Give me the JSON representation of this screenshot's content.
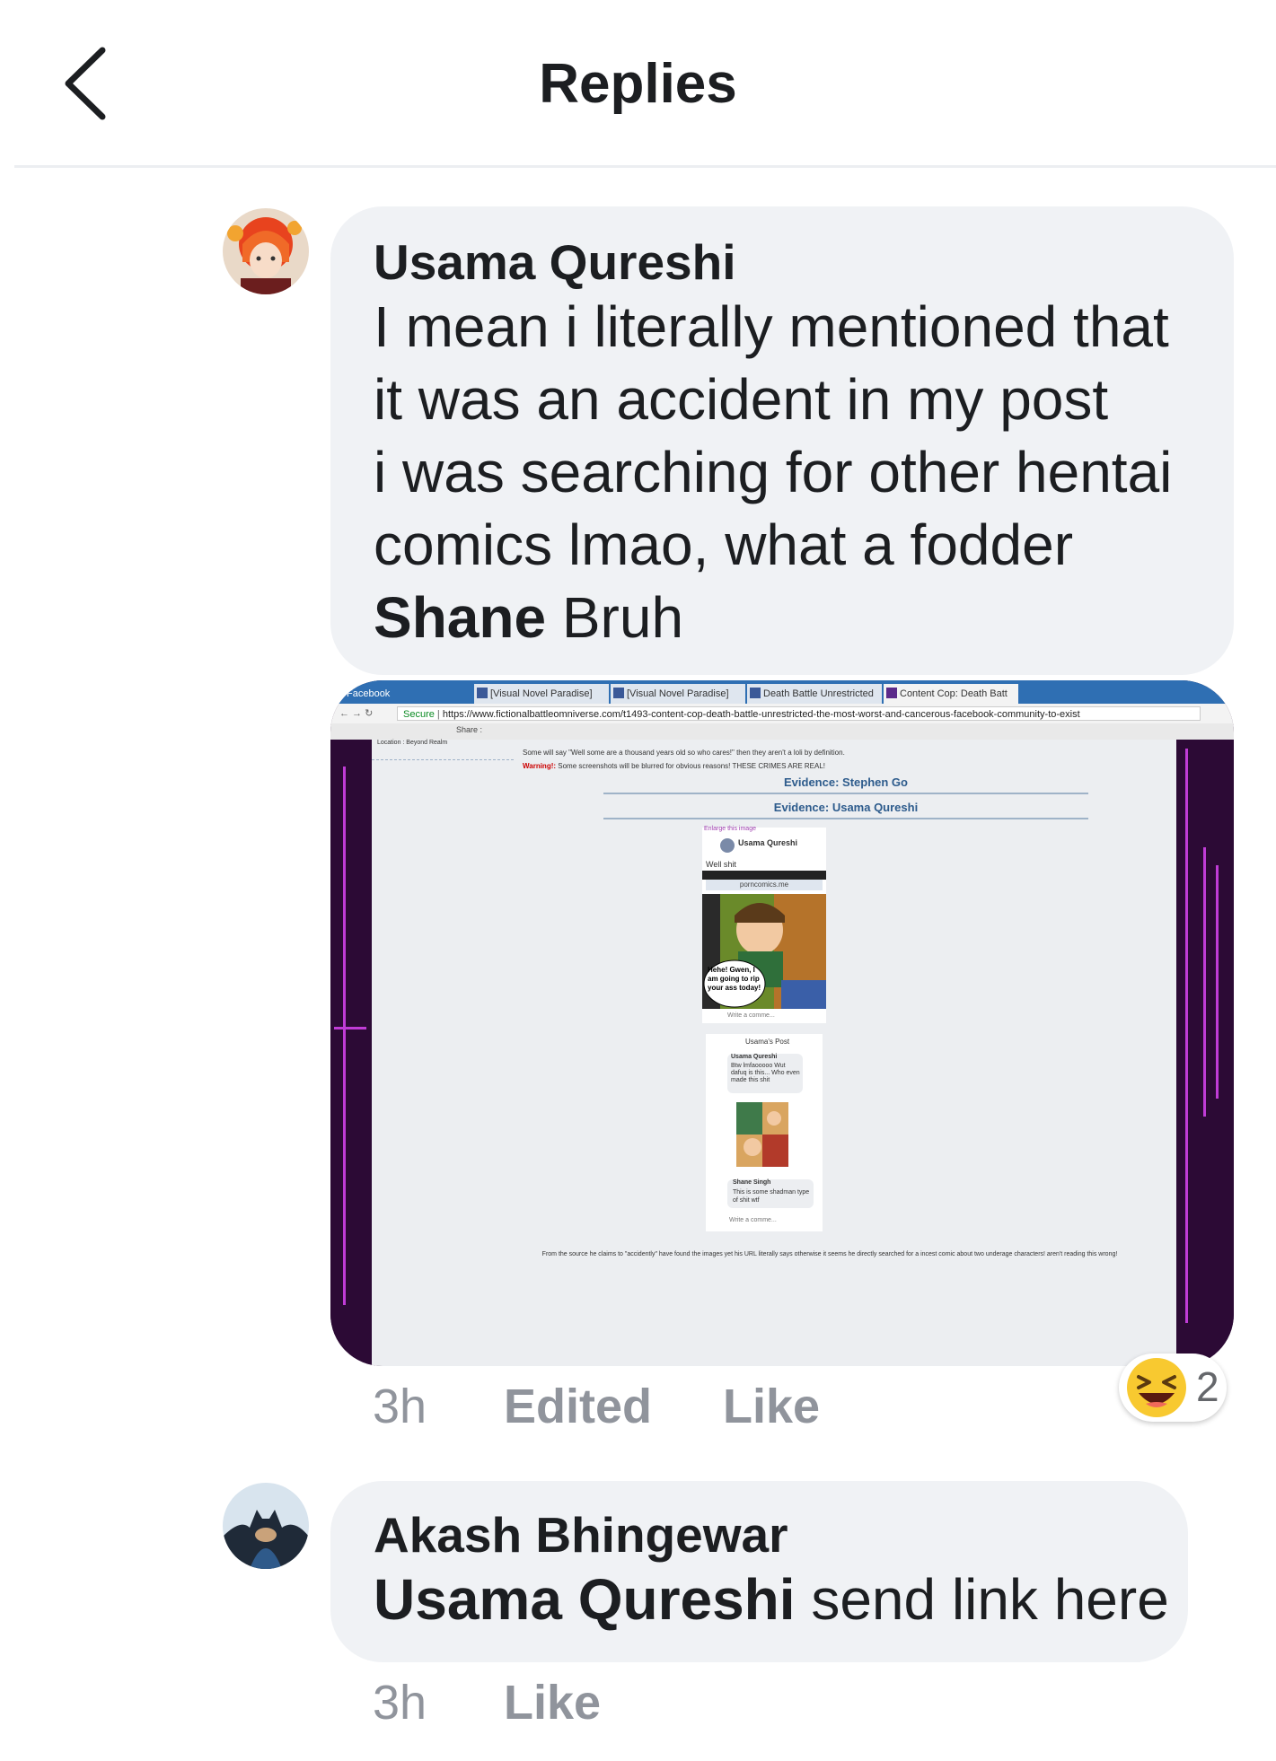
{
  "header": {
    "title": "Replies"
  },
  "comments": [
    {
      "author": "Usama Qureshi",
      "text_lines": [
        "I mean i literally mentioned that",
        "it was an accident in my post",
        "i was searching for other hentai",
        "comics lmao, what a fodder"
      ],
      "mention": "Shane",
      "text_after_mention": " Bruh",
      "time": "3h",
      "edited_label": "Edited",
      "like_label": "Like",
      "reaction": {
        "icon": "laughing-emoji-icon",
        "count": "2"
      },
      "attachment": {
        "browser_tabs": [
          "Facebook",
          "[Visual Novel Paradise]",
          "[Visual Novel Paradise]",
          "Death Battle Unrestricted",
          "Content Cop: Death Batt"
        ],
        "secure_label": "Secure",
        "url": "https://www.fictionalbattleomniverse.com/t1493-content-cop-death-battle-unrestricted-the-most-worst-and-cancerous-facebook-community-to-exist",
        "location_label": "Location : Beyond Realm",
        "share_label": "Share :",
        "line_thousand": "Some will say \"Well some are a thousand years old so who cares!\" then they aren't a loli by definition.",
        "warning_prefix": "Warning!:",
        "warning_text": "Some screenshots will be blurred for obvious reasons! THESE CRIMES ARE REAL!",
        "evidence_1": "Evidence: Stephen Go",
        "evidence_2": "Evidence: Usama Qureshi",
        "enlarge_label": "Enlarge this image",
        "phone1_author": "Usama Qureshi",
        "phone1_text": "Well shit",
        "phone1_site": "porncomics.me",
        "comic_speech": "Hehe! Gwen, I am going to rip your ass today!",
        "write_comment": "Write a comme...",
        "phone2_title": "Usama's Post",
        "phone2_author": "Usama Qureshi",
        "phone2_text": "Btw lmfaooooo Wut dafuq is this... Who even made this shit",
        "phone2_reply_author": "Shane Singh",
        "phone2_reply_text": "This is some shadman type of shit wtf",
        "footnote": "From the source he claims to \"accidently\" have found the images yet his URL literally says otherwise it seems he directly searched for a incest comic about two underage characters! aren't reading this wrong!"
      }
    },
    {
      "author": "Akash Bhingewar",
      "mention": "Usama Qureshi",
      "text_after_mention": " send link here",
      "time": "3h",
      "like_label": "Like"
    }
  ]
}
